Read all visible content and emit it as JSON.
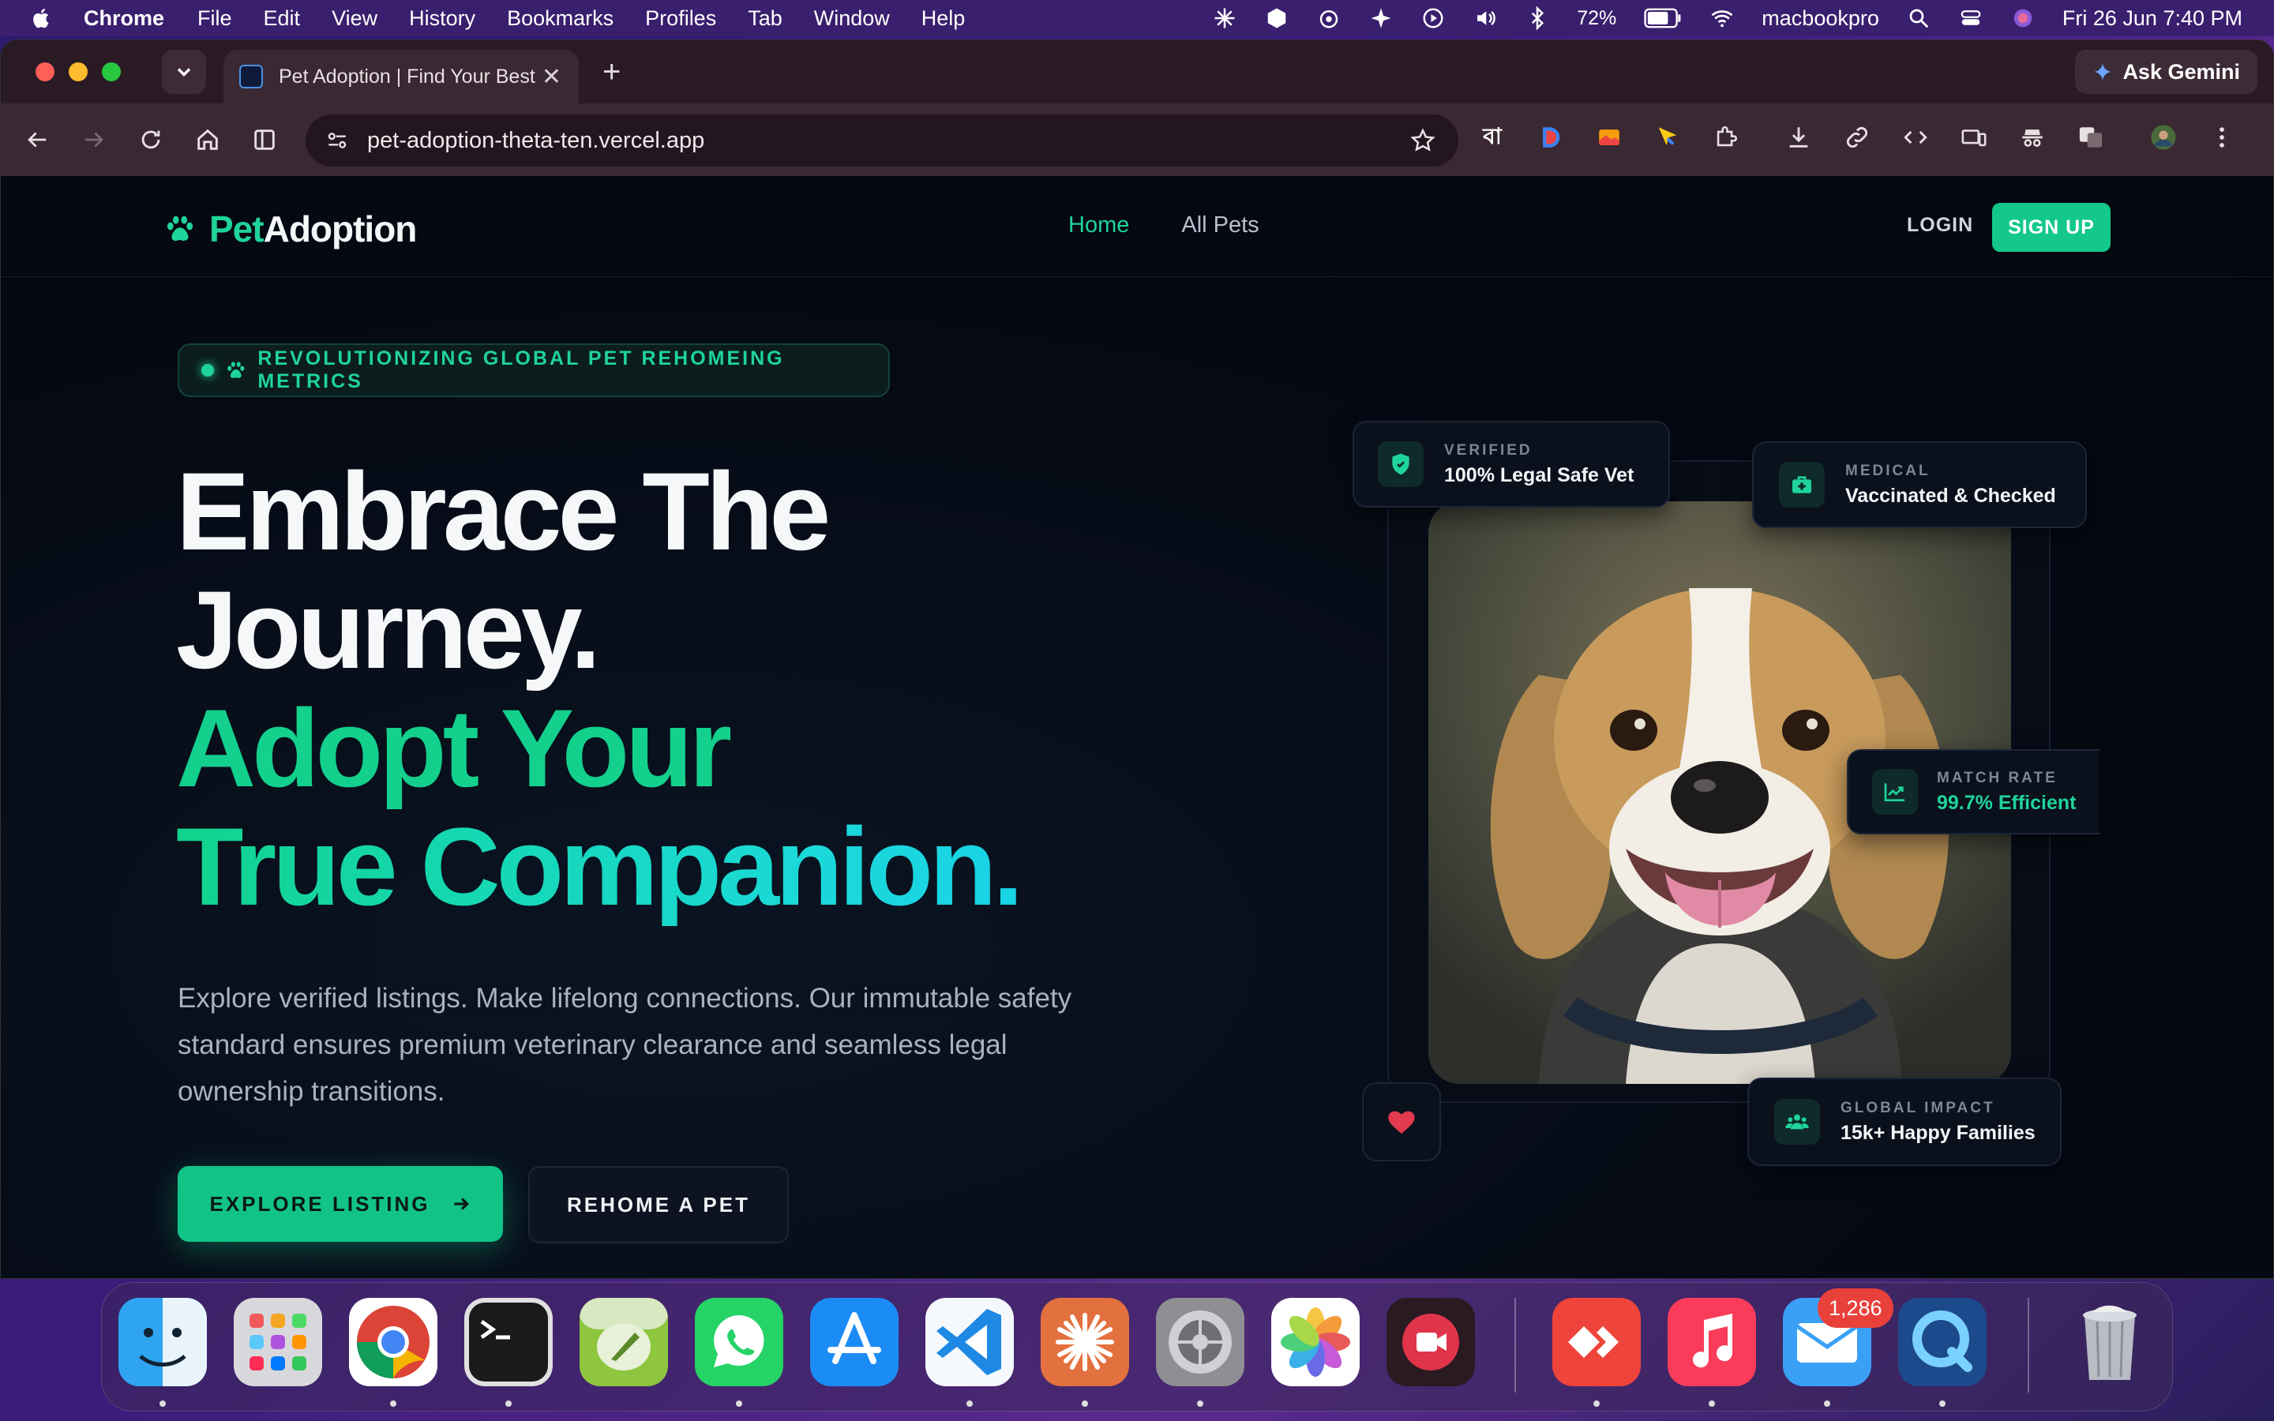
{
  "menubar": {
    "app_name": "Chrome",
    "items": [
      "File",
      "Edit",
      "View",
      "History",
      "Bookmarks",
      "Profiles",
      "Tab",
      "Window",
      "Help"
    ],
    "battery": "72%",
    "wifi_name": "macbookpro",
    "datetime": "Fri 26 Jun  7:40 PM"
  },
  "browser": {
    "tab_title": "Pet Adoption | Find Your Best",
    "ask_gemini": "Ask Gemini",
    "url": "pet-adoption-theta-ten.vercel.app",
    "ext_bengali": "বা"
  },
  "site": {
    "logo_pet": "Pet",
    "logo_adoption": "Adoption",
    "nav": {
      "home": "Home",
      "all_pets": "All Pets"
    },
    "login": "LOGIN",
    "signup": "SIGN UP",
    "badge": "REVOLUTIONIZING GLOBAL PET REHOMEING METRICS",
    "headline": {
      "line1": "Embrace The",
      "line2": "Journey.",
      "line3": "Adopt Your",
      "line4": "True Companion."
    },
    "lede": "Explore verified listings. Make lifelong connections. Our immutable safety standard ensures premium veterinary clearance and seamless legal ownership transitions.",
    "cta_primary": "EXPLORE LISTING",
    "cta_secondary": "REHOME A PET",
    "cards": {
      "verified": {
        "label": "VERIFIED",
        "value": "100% Legal Safe Vet"
      },
      "medical": {
        "label": "MEDICAL",
        "value": "Vaccinated & Checked"
      },
      "match": {
        "label": "MATCH RATE",
        "value": "99.7% Efficient"
      },
      "impact": {
        "label": "GLOBAL IMPACT",
        "value": "15k+ Happy Families"
      }
    }
  },
  "dock": {
    "mail_badge": "1,286"
  },
  "colors": {
    "accent": "#1fd49a",
    "page_bg": "#050913",
    "cyan": "#19d3e6"
  }
}
